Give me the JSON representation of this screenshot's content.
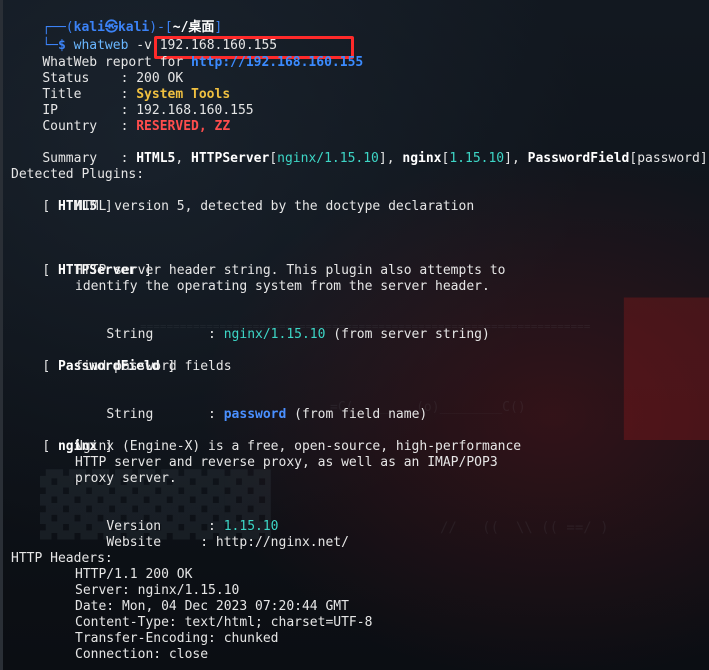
{
  "prompt": {
    "corner_top": "┌──",
    "open_paren": "(",
    "user": "kali",
    "at": "㉿",
    "host": "kali",
    "close_paren": ")",
    "dash": "-",
    "dir_open": "[",
    "dir": "~/桌面",
    "dir_close": "]",
    "corner_bottom": "└─",
    "symbol": "$",
    "command_name": "whatweb",
    "command_args": " -v 192.168.160.155"
  },
  "report": {
    "header_label": "WhatWeb report for ",
    "url": "http://192.168.160.155",
    "status_label": "Status    : ",
    "status_value": "200 OK",
    "title_label": "Title     : ",
    "title_value": "System Tools",
    "ip_label": "IP        : ",
    "ip_value": "192.168.160.155",
    "country_label": "Country   : ",
    "country_value": "RESERVED, ZZ",
    "summary_label": "Summary   : ",
    "summary_parts": {
      "p1": "HTML5",
      "p2": ", ",
      "p3": "HTTPServer",
      "p4": "[",
      "p5": "nginx/1.15.10",
      "p6": "], ",
      "p7": "nginx",
      "p8": "[",
      "p9": "1.15.10",
      "p10": "], ",
      "p11": "PasswordField",
      "p12": "[password]"
    }
  },
  "plugins": {
    "heading": "Detected Plugins:",
    "html5": {
      "open": "[ ",
      "name": "HTML5",
      "close": " ]",
      "desc": "HTML version 5, detected by the doctype declaration"
    },
    "httpserver": {
      "open": "[ ",
      "name": "HTTPServer",
      "close": " ]",
      "desc1": "HTTP server header string. This plugin also attempts to",
      "desc2": "identify the operating system from the server header.",
      "string_label": "String       : ",
      "string_value": "nginx/1.15.10",
      "string_note": " (from server string)"
    },
    "passwordfield": {
      "open": "[ ",
      "name": "PasswordField",
      "close": " ]",
      "desc": "find password fields",
      "string_label": "String       : ",
      "string_value": "password",
      "string_note": " (from field name)"
    },
    "nginx": {
      "open": "[ ",
      "name": "nginx",
      "close": " ]",
      "desc1": "Nginx (Engine-X) is a free, open-source, high-performance",
      "desc2": "HTTP server and reverse proxy, as well as an IMAP/POP3",
      "desc3": "proxy server.",
      "version_label": "Version      : ",
      "version_value": "1.15.10",
      "website_label": "Website     : ",
      "website_value": "http://nginx.net/"
    }
  },
  "headers": {
    "heading": "HTTP Headers:",
    "lines": [
      "HTTP/1.1 200 OK",
      "Server: nginx/1.15.10",
      "Date: Mon, 04 Dec 2023 07:20:44 GMT",
      "Content-Type: text/html; charset=UTF-8",
      "Transfer-Encoding: chunked",
      "Connection: close"
    ]
  },
  "colors": {
    "url": "#3b8bff",
    "title": "#f0c040",
    "country": "#ff4d4d",
    "plugin_value": "#3dd6c6",
    "highlight_box": "#ff2a2a"
  }
}
